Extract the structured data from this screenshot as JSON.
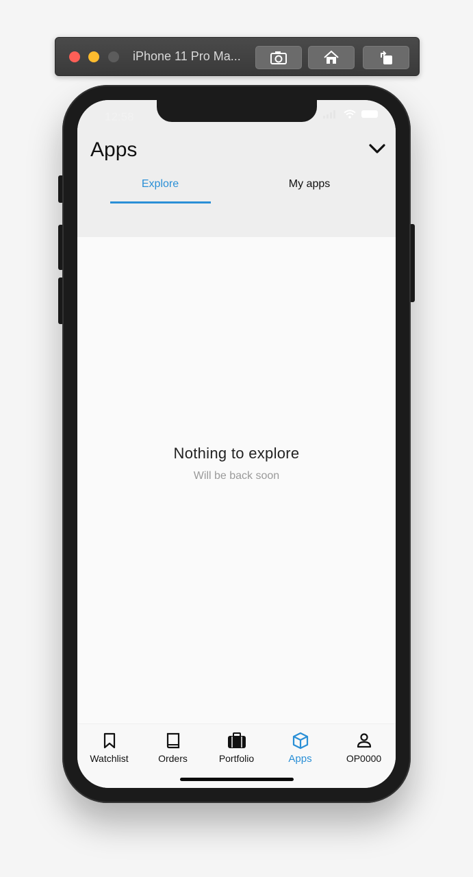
{
  "simulator": {
    "title": "iPhone 11 Pro Ma..."
  },
  "status_bar": {
    "time": "12:58"
  },
  "header": {
    "title": "Apps"
  },
  "tabs": [
    {
      "label": "Explore",
      "active": true
    },
    {
      "label": "My apps",
      "active": false
    }
  ],
  "empty_state": {
    "title": "Nothing to explore",
    "subtitle": "Will be back soon"
  },
  "bottom_nav": [
    {
      "label": "Watchlist",
      "icon": "bookmark-icon"
    },
    {
      "label": "Orders",
      "icon": "book-icon"
    },
    {
      "label": "Portfolio",
      "icon": "briefcase-icon"
    },
    {
      "label": "Apps",
      "icon": "cube-icon",
      "active": true
    },
    {
      "label": "OP0000",
      "icon": "user-icon"
    }
  ],
  "colors": {
    "accent": "#2a8fd6",
    "appbar_bg": "#eeeeee",
    "content_bg": "#fafafa"
  }
}
